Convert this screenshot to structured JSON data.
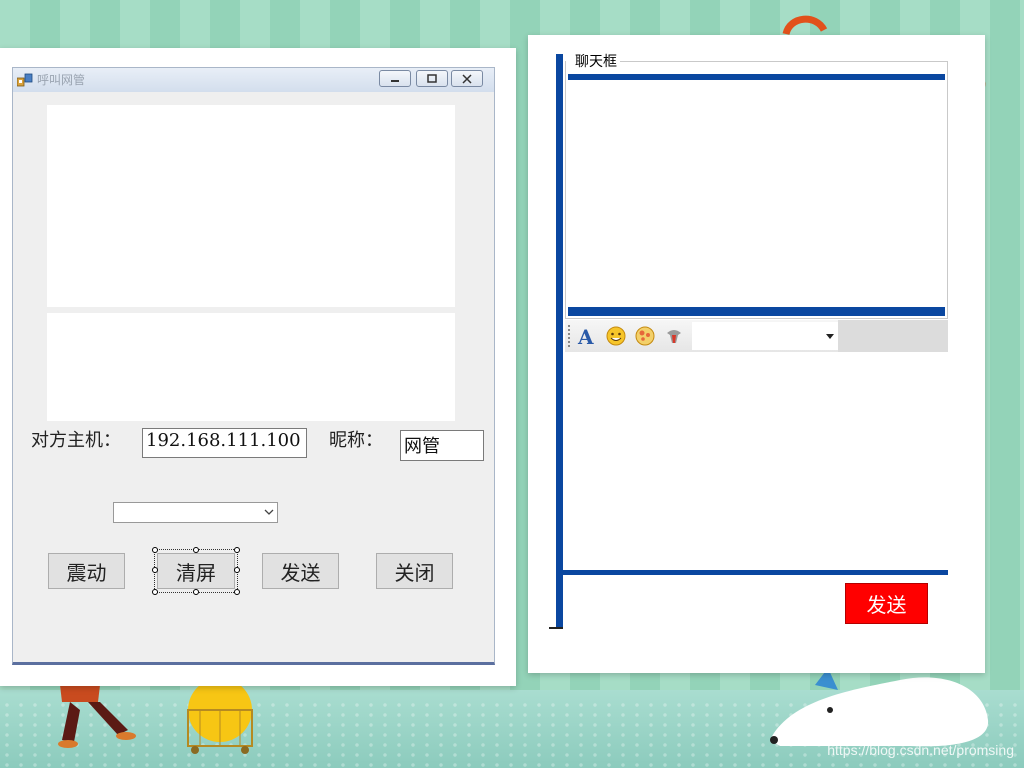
{
  "left_window": {
    "title": "呼叫网管",
    "labels": {
      "host": "对方主机：",
      "nickname": "昵称："
    },
    "fields": {
      "host_value": "192.168.111.100",
      "nickname_value": "网管"
    },
    "dropdown": {
      "value": ""
    },
    "buttons": {
      "shake": "震动",
      "clear": "清屏",
      "send": "发送",
      "close": "关闭"
    }
  },
  "right_window": {
    "group_title": "聊天框",
    "toolbar": {
      "icons": [
        "font-icon",
        "smiley-icon",
        "emoticon-icon",
        "shake-icon"
      ],
      "font_value": ""
    },
    "send_label": "发送",
    "colors": {
      "accent_bar": "#0a47a0",
      "send_button": "#ff0000"
    }
  },
  "watermark": "https://blog.csdn.net/promsing"
}
